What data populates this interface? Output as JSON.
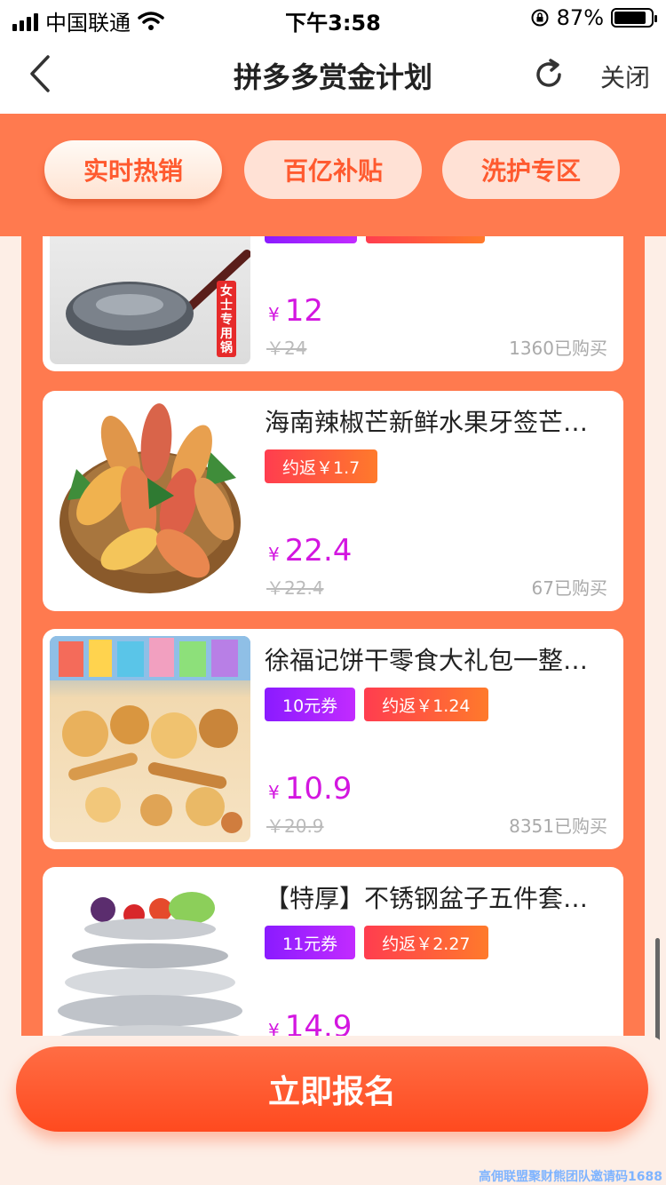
{
  "status_bar": {
    "carrier": "中国联通",
    "time": "下午3:58",
    "battery": "87%",
    "battery_level": 0.87
  },
  "nav": {
    "title": "拼多多赏金计划",
    "close_label": "关闭"
  },
  "tabs": [
    {
      "label": "实时热销",
      "active": true
    },
    {
      "label": "百亿补贴",
      "active": false
    },
    {
      "label": "洗护专区",
      "active": false
    }
  ],
  "products": [
    {
      "name": "",
      "tags": [],
      "price": "12",
      "original_price": "￥24",
      "sold": "1360已购买",
      "image": "wok-icon"
    },
    {
      "name": "海南辣椒芒新鲜水果牙签芒…",
      "tags": [
        {
          "type": "rebate",
          "text": "约返￥1.7"
        }
      ],
      "price": "22.4",
      "original_price": "￥22.4",
      "sold": "67已购买",
      "image": "mango-basket-icon"
    },
    {
      "name": "徐福记饼干零食大礼包一整…",
      "tags": [
        {
          "type": "coupon",
          "text": "10元券"
        },
        {
          "type": "rebate",
          "text": "约返￥1.24"
        }
      ],
      "price": "10.9",
      "original_price": "￥20.9",
      "sold": "8351已购买",
      "image": "snack-pile-icon"
    },
    {
      "name": "【特厚】不锈钢盆子五件套…",
      "tags": [
        {
          "type": "coupon",
          "text": "11元券"
        },
        {
          "type": "rebate",
          "text": "约返￥2.27"
        }
      ],
      "price": "14.9",
      "original_price": "",
      "sold": "",
      "image": "steel-bowls-icon"
    }
  ],
  "wok_badge": "女士专用锅",
  "currency": "¥",
  "cta": {
    "label": "立即报名"
  },
  "watermark": "高佣联盟聚财熊团队邀请码1688"
}
